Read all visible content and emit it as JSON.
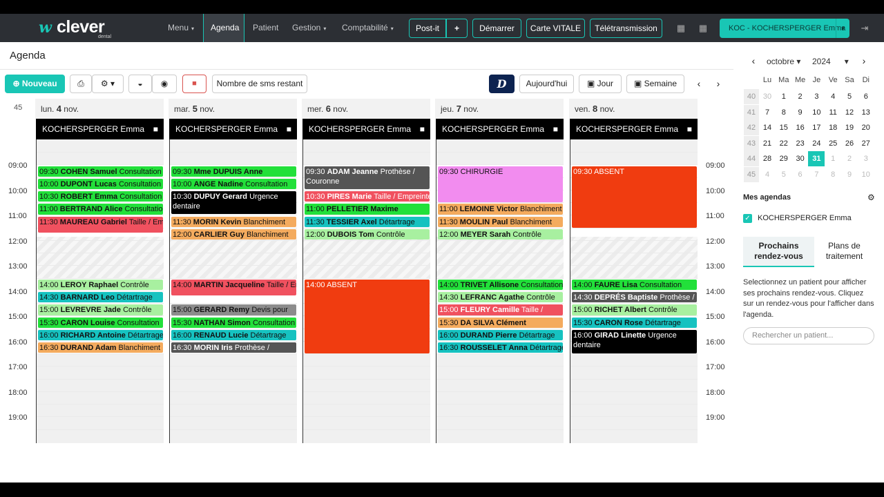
{
  "brand": {
    "mark": "w",
    "name": "clever",
    "sub": "dental"
  },
  "nav": {
    "menu": "Menu",
    "agenda": "Agenda",
    "patient": "Patient",
    "gestion": "Gestion",
    "comptabilite": "Comptabilité"
  },
  "toolbar_top": {
    "postit": "Post-it",
    "plus": "+",
    "demarrer": "Démarrer",
    "carte_vitale": "Carte VITALE",
    "teletransmission": "Télétransmission"
  },
  "user": {
    "label": "KOC - KOCHERSPERGER Emma"
  },
  "icons": {
    "chevron_down": "▾",
    "calendar": "▦",
    "grid": "▦",
    "logout": "⇥",
    "print": "⎙",
    "gear": "⚙",
    "mask": "◒",
    "eye": "◉",
    "lock": "🔒",
    "prev": "‹",
    "next": "›",
    "comment": "▬",
    "check": "✓"
  },
  "page": {
    "title": "Agenda"
  },
  "toolbar": {
    "new": "Nouveau",
    "sms": "Nombre de sms restant",
    "doctolib": "D",
    "today": "Aujourd'hui",
    "day": "Jour",
    "week": "Semaine"
  },
  "week_number": "45",
  "hours": [
    "09:00",
    "10:00",
    "11:00",
    "12:00",
    "13:00",
    "14:00",
    "15:00",
    "16:00",
    "17:00",
    "18:00",
    "19:00"
  ],
  "days": [
    {
      "dow": "lun.",
      "num": "4",
      "mon": "nov.",
      "doctor": "KOCHERSPERGER Emma",
      "events": [
        {
          "time": "09:30",
          "name": "COHEN Samuel",
          "act": "Consultation",
          "color": "#22e03a",
          "start": 9.5,
          "dur": 0.42
        },
        {
          "time": "10:00",
          "name": "DUPONT Lucas",
          "act": "Consultation",
          "color": "#22e03a",
          "start": 10.0,
          "dur": 0.42
        },
        {
          "time": "10:30",
          "name": "ROBERT Emma",
          "act": "Consultation",
          "color": "#22e03a",
          "start": 10.5,
          "dur": 0.42
        },
        {
          "time": "11:00",
          "name": "BERTRAND Alice",
          "act": "Consultation",
          "color": "#22e03a",
          "start": 11.0,
          "dur": 0.42
        },
        {
          "time": "11:30",
          "name": "MAUREAU Gabriel",
          "act": "Taille / Empreinte",
          "color": "#f0515f",
          "start": 11.5,
          "dur": 0.65
        },
        {
          "time": "14:00",
          "name": "LEROY Raphael",
          "act": "Contrôle",
          "color": "#a8f0a0",
          "start": 14.0,
          "dur": 0.42
        },
        {
          "time": "14:30",
          "name": "BARNARD Leo",
          "act": "Détartrage",
          "color": "#16c2c0",
          "start": 14.5,
          "dur": 0.42
        },
        {
          "time": "15:00",
          "name": "LEVREVRE Jade",
          "act": "Contrôle",
          "color": "#a8f0a0",
          "start": 15.0,
          "dur": 0.42
        },
        {
          "time": "15:30",
          "name": "CARON Louise",
          "act": "Consultation",
          "color": "#22e03a",
          "start": 15.5,
          "dur": 0.42
        },
        {
          "time": "16:00",
          "name": "RICHARD Antoine",
          "act": "Détartrage",
          "color": "#16c2c0",
          "start": 16.0,
          "dur": 0.42
        },
        {
          "time": "16:30",
          "name": "DURAND Adam",
          "act": "Blanchiment",
          "color": "#f4ab5e",
          "start": 16.5,
          "dur": 0.42
        }
      ]
    },
    {
      "dow": "mar.",
      "num": "5",
      "mon": "nov.",
      "doctor": "KOCHERSPERGER Emma",
      "events": [
        {
          "time": "09:30",
          "name": "Mme DUPUIS Anne",
          "act": "",
          "color": "#22e03a",
          "start": 9.5,
          "dur": 0.42
        },
        {
          "time": "10:00",
          "name": "ANGE Nadine",
          "act": "Consultation",
          "color": "#22e03a",
          "start": 10.0,
          "dur": 0.42
        },
        {
          "time": "10:30",
          "name": "DUPUY Gerard",
          "act": "Urgence dentaire",
          "color": "#000000",
          "text": "#ffffff",
          "start": 10.5,
          "dur": 0.9,
          "tall": true
        },
        {
          "time": "11:30",
          "name": "MORIN Kevin",
          "act": "Blanchiment",
          "color": "#f4ab5e",
          "start": 11.5,
          "dur": 0.42
        },
        {
          "time": "12:00",
          "name": "CARLIER Guy",
          "act": "Blanchiment",
          "color": "#f4ab5e",
          "start": 12.0,
          "dur": 0.42
        },
        {
          "time": "14:00",
          "name": "MARTIN Jacqueline",
          "act": "Taille / Empreinte",
          "color": "#f0515f",
          "start": 14.0,
          "dur": 0.65
        },
        {
          "time": "15:00",
          "name": "GERARD Remy",
          "act": "Devis pour",
          "color": "#8c8c8c",
          "start": 15.0,
          "dur": 0.42
        },
        {
          "time": "15:30",
          "name": "NATHAN Simon",
          "act": "Consultation",
          "color": "#22e03a",
          "start": 15.5,
          "dur": 0.42
        },
        {
          "time": "16:00",
          "name": "RENAUD Lucie",
          "act": "Détartrage",
          "color": "#16c2c0",
          "start": 16.0,
          "dur": 0.42
        },
        {
          "time": "16:30",
          "name": "MORIN Iris",
          "act": "Prothèse /",
          "color": "#555555",
          "text": "#ffffff",
          "start": 16.5,
          "dur": 0.42
        }
      ]
    },
    {
      "dow": "mer.",
      "num": "6",
      "mon": "nov.",
      "doctor": "KOCHERSPERGER Emma",
      "events": [
        {
          "time": "09:30",
          "name": "ADAM Jeanne",
          "act": "Prothèse / Couronne",
          "color": "#555555",
          "text": "#ffffff",
          "start": 9.5,
          "dur": 0.92,
          "tall": true
        },
        {
          "time": "10:30",
          "name": "PIRES Marie",
          "act": "Taille / Empreinte",
          "color": "#f0515f",
          "text": "#ffffff",
          "start": 10.5,
          "dur": 0.42
        },
        {
          "time": "11:00",
          "name": "PELLETIER Maxime",
          "act": "",
          "color": "#22e03a",
          "start": 11.0,
          "dur": 0.42
        },
        {
          "time": "11:30",
          "name": "TESSIER Axel",
          "act": "Détartrage",
          "color": "#16c2c0",
          "start": 11.5,
          "dur": 0.42
        },
        {
          "time": "12:00",
          "name": "DUBOIS Tom",
          "act": "Contrôle",
          "color": "#a8f0a0",
          "start": 12.0,
          "dur": 0.42
        },
        {
          "time": "14:00",
          "name": "",
          "act": "ABSENT",
          "color": "#f03c10",
          "text": "#ffffff",
          "start": 14.0,
          "dur": 2.95
        }
      ]
    },
    {
      "dow": "jeu.",
      "num": "7",
      "mon": "nov.",
      "doctor": "KOCHERSPERGER Emma",
      "events": [
        {
          "time": "09:30",
          "name": "",
          "act": "CHIRURGIE",
          "color": "#f28cef",
          "start": 9.5,
          "dur": 1.45
        },
        {
          "time": "11:00",
          "name": "LEMOINE Victor",
          "act": "Blanchiment",
          "color": "#f4ab5e",
          "start": 11.0,
          "dur": 0.42
        },
        {
          "time": "11:30",
          "name": "MOULIN Paul",
          "act": "Blanchiment",
          "color": "#f4ab5e",
          "start": 11.5,
          "dur": 0.42
        },
        {
          "time": "12:00",
          "name": "MEYER Sarah",
          "act": "Contrôle",
          "color": "#a8f0a0",
          "start": 12.0,
          "dur": 0.42
        },
        {
          "time": "14:00",
          "name": "TRIVET Allisone",
          "act": "Consultation",
          "color": "#22e03a",
          "start": 14.0,
          "dur": 0.42
        },
        {
          "time": "14:30",
          "name": "LEFRANC Agathe",
          "act": "Contrôle",
          "color": "#a8f0a0",
          "start": 14.5,
          "dur": 0.42
        },
        {
          "time": "15:00",
          "name": "FLEURY Camille",
          "act": "Taille /",
          "color": "#f0515f",
          "text": "#ffffff",
          "start": 15.0,
          "dur": 0.42
        },
        {
          "time": "15:30",
          "name": "DA SILVA Clément",
          "act": "",
          "color": "#f4ab5e",
          "start": 15.5,
          "dur": 0.42
        },
        {
          "time": "16:00",
          "name": "DURAND Pierre",
          "act": "Détartrage",
          "color": "#16c2c0",
          "start": 16.0,
          "dur": 0.42
        },
        {
          "time": "16:30",
          "name": "ROUSSELET Anna",
          "act": "Détartrage",
          "color": "#16c2c0",
          "start": 16.5,
          "dur": 0.42
        }
      ]
    },
    {
      "dow": "ven.",
      "num": "8",
      "mon": "nov.",
      "doctor": "KOCHERSPERGER Emma",
      "events": [
        {
          "time": "09:30",
          "name": "",
          "act": "ABSENT",
          "color": "#f03c10",
          "text": "#ffffff",
          "start": 9.5,
          "dur": 2.45
        },
        {
          "time": "14:00",
          "name": "FAURE Lisa",
          "act": "Consultation",
          "color": "#22e03a",
          "start": 14.0,
          "dur": 0.42
        },
        {
          "time": "14:30",
          "name": "DEPRÉS Baptiste",
          "act": "Prothèse /",
          "color": "#555555",
          "text": "#ffffff",
          "start": 14.5,
          "dur": 0.42
        },
        {
          "time": "15:00",
          "name": "RICHET Albert",
          "act": "Contrôle",
          "color": "#a8f0a0",
          "start": 15.0,
          "dur": 0.42
        },
        {
          "time": "15:30",
          "name": "CARON Rose",
          "act": "Détartrage",
          "color": "#16c2c0",
          "start": 15.5,
          "dur": 0.42
        },
        {
          "time": "16:00",
          "name": "GIRAD Linette",
          "act": "Urgence dentaire",
          "color": "#000000",
          "text": "#ffffff",
          "start": 16.0,
          "dur": 0.95,
          "tall": true
        }
      ]
    }
  ],
  "sidebar": {
    "month": "octobre",
    "year": "2024",
    "dow": [
      "Lu",
      "Ma",
      "Me",
      "Je",
      "Ve",
      "Sa",
      "Di"
    ],
    "weeks": [
      {
        "wk": "40",
        "days": [
          "30",
          "1",
          "2",
          "3",
          "4",
          "5",
          "6"
        ],
        "dim": [
          0
        ]
      },
      {
        "wk": "41",
        "days": [
          "7",
          "8",
          "9",
          "10",
          "11",
          "12",
          "13"
        ],
        "dim": []
      },
      {
        "wk": "42",
        "days": [
          "14",
          "15",
          "16",
          "17",
          "18",
          "19",
          "20"
        ],
        "dim": []
      },
      {
        "wk": "43",
        "days": [
          "21",
          "22",
          "23",
          "24",
          "25",
          "26",
          "27"
        ],
        "dim": []
      },
      {
        "wk": "44",
        "days": [
          "28",
          "29",
          "30",
          "31",
          "1",
          "2",
          "3"
        ],
        "dim": [
          4,
          5,
          6
        ],
        "today": 3
      },
      {
        "wk": "45",
        "days": [
          "4",
          "5",
          "6",
          "7",
          "8",
          "9",
          "10"
        ],
        "dim": [
          0,
          1,
          2,
          3,
          4,
          5,
          6
        ]
      }
    ],
    "my_agendas": "Mes agendas",
    "agenda_item": "KOCHERSPERGER Emma",
    "tab_next": "Prochains rendez-vous",
    "tab_plans": "Plans de traitement",
    "info": "Selectionnez un patient pour afficher ses prochains rendez-vous. Cliquez sur un rendez-vous pour l'afficher dans l'agenda.",
    "search_placeholder": "Rechercher un patient..."
  }
}
